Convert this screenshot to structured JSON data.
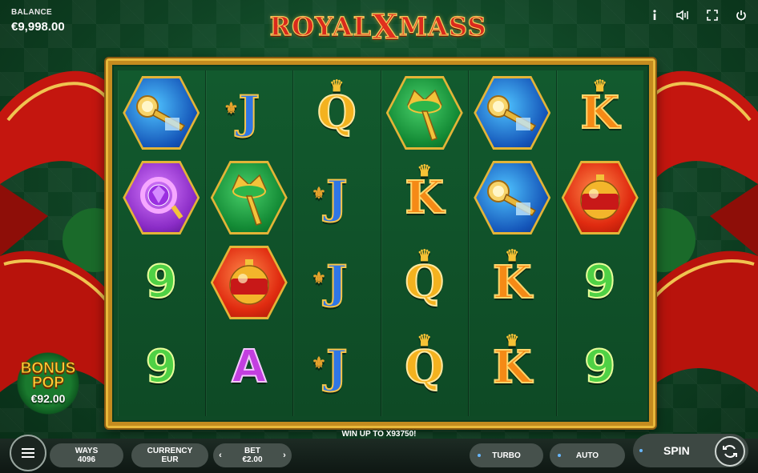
{
  "balance": {
    "label": "BALANCE",
    "value": "€9,998.00"
  },
  "logo": {
    "part1": "ROYAL",
    "x": "X",
    "part2": "MASS"
  },
  "top_icons": [
    "info-icon",
    "sound-icon",
    "fullscreen-icon",
    "power-icon"
  ],
  "reels": [
    [
      {
        "kind": "hex",
        "style": "blue",
        "icon": "trumpet-icon"
      },
      {
        "kind": "hex",
        "style": "purple",
        "icon": "ring-icon"
      },
      {
        "kind": "letter",
        "text": "9"
      },
      {
        "kind": "letter",
        "text": "9"
      }
    ],
    [
      {
        "kind": "letter",
        "text": "J"
      },
      {
        "kind": "hex",
        "style": "green",
        "icon": "scepter-icon"
      },
      {
        "kind": "hex",
        "style": "red",
        "icon": "ornament-icon"
      },
      {
        "kind": "letter",
        "text": "A"
      }
    ],
    [
      {
        "kind": "letter",
        "text": "Q"
      },
      {
        "kind": "letter",
        "text": "J"
      },
      {
        "kind": "letter",
        "text": "J"
      },
      {
        "kind": "letter",
        "text": "J"
      }
    ],
    [
      {
        "kind": "hex",
        "style": "green",
        "icon": "scepter-icon"
      },
      {
        "kind": "letter",
        "text": "K"
      },
      {
        "kind": "letter",
        "text": "Q"
      },
      {
        "kind": "letter",
        "text": "Q"
      }
    ],
    [
      {
        "kind": "hex",
        "style": "blue",
        "icon": "trumpet-icon"
      },
      {
        "kind": "hex",
        "style": "blue",
        "icon": "trumpet-icon"
      },
      {
        "kind": "letter",
        "text": "K"
      },
      {
        "kind": "letter",
        "text": "K"
      }
    ],
    [
      {
        "kind": "letter",
        "text": "K"
      },
      {
        "kind": "hex",
        "style": "red",
        "icon": "ornament-icon"
      },
      {
        "kind": "letter",
        "text": "9"
      },
      {
        "kind": "letter",
        "text": "9"
      }
    ]
  ],
  "bonus": {
    "line1": "BONUS",
    "line2": "POP",
    "amount": "€92.00"
  },
  "win_up": "WIN UP TO X93750!",
  "bottom": {
    "ways_label": "WAYS",
    "ways_value": "4096",
    "currency_label": "CURRENCY",
    "currency_value": "EUR",
    "bet_label": "BET",
    "bet_value": "€2.00",
    "turbo_label": "TURBO",
    "auto_label": "AUTO",
    "spin_label": "SPIN"
  }
}
